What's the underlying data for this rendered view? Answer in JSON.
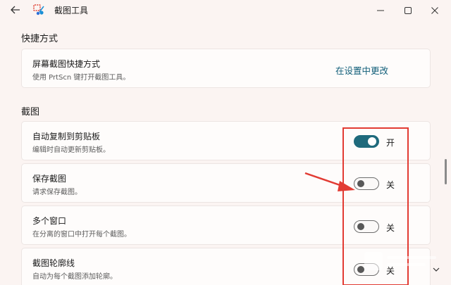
{
  "titlebar": {
    "title": "截图工具",
    "back_icon": "back-arrow-icon",
    "app_icon": "snipping-tool-icon",
    "minimize_icon": "minimize-icon",
    "maximize_icon": "maximize-icon",
    "close_icon": "close-icon"
  },
  "shortcut_section": {
    "title": "快捷方式",
    "card": {
      "title": "屏幕截图快捷方式",
      "description": "使用 PrtScn 键打开截图工具。",
      "link": "在设置中更改"
    }
  },
  "snip_section": {
    "title": "截图",
    "items": [
      {
        "title": "自动复制到剪贴板",
        "description": "编辑时自动更新剪贴板。",
        "toggle_on": true,
        "toggle_label": "开"
      },
      {
        "title": "保存截图",
        "description": "请求保存截图。",
        "toggle_on": false,
        "toggle_label": "关"
      },
      {
        "title": "多个窗口",
        "description": "在分离的窗口中打开每个截图。",
        "toggle_on": false,
        "toggle_label": "关"
      },
      {
        "title": "截图轮廓线",
        "description": "自动为每个截图添加轮廓。",
        "toggle_on": false,
        "toggle_label": "关",
        "expand_icon": "chevron-down-icon"
      }
    ]
  },
  "annotation": {
    "box_color": "#e23b33",
    "arrow_color": "#e23b33"
  },
  "colors": {
    "accent": "#1f6a7c",
    "link": "#0f5d78",
    "background": "#fbf4f2"
  }
}
